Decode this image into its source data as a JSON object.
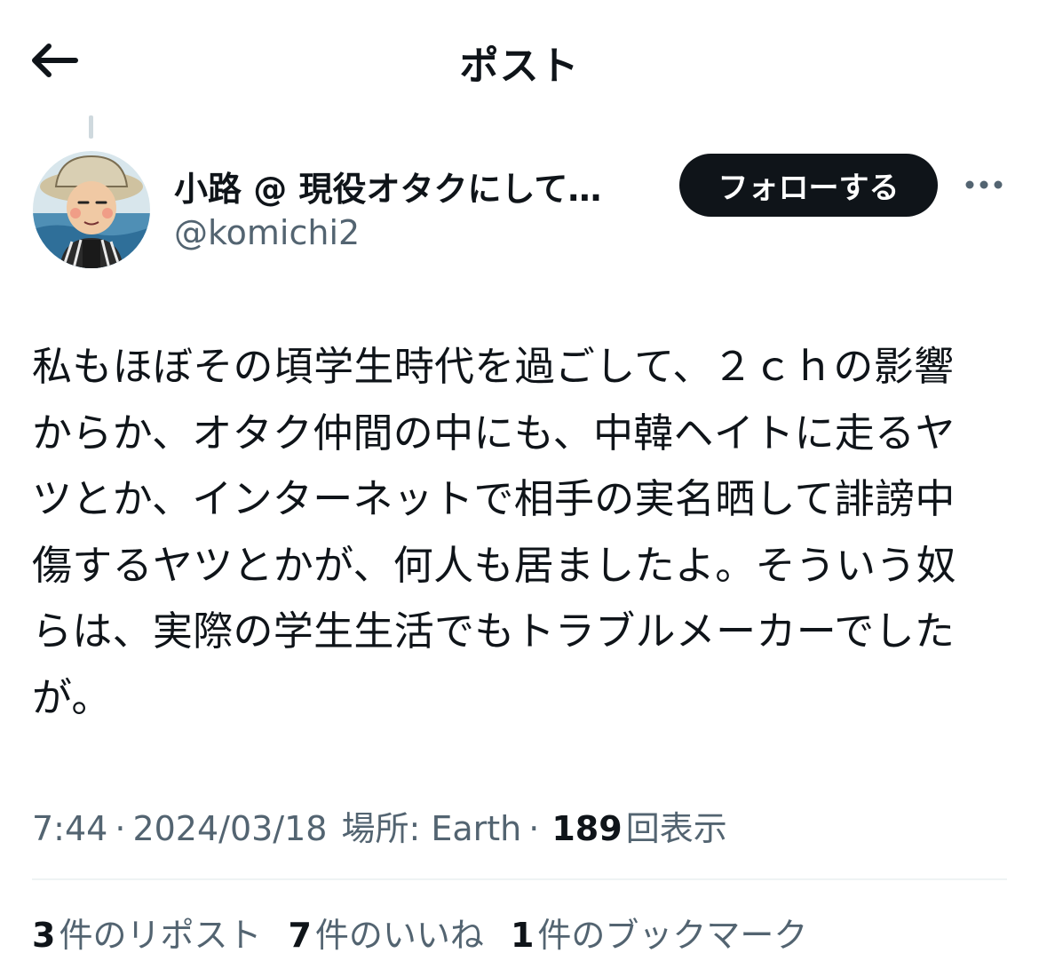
{
  "header": {
    "title": "ポスト",
    "back_icon": "arrow-left-icon"
  },
  "author": {
    "name": "小路 @ 現役オタクにして…",
    "handle": "@komichi2",
    "follow_label": "フォローする",
    "more_icon": "ellipsis-icon"
  },
  "post": {
    "text": "私もほぼその頃学生時代を過ごして、２ｃｈの影響\nからか、オタク仲間の中にも、中韓ヘイトに走るヤ\nツとか、インターネットで相手の実名晒して誹謗中\n傷するヤツとかが、何人も居ましたよ。そういう奴\nらは、実際の学生生活でもトラブルメーカーでした\nが。",
    "time": "7:44",
    "date": "2024/03/18",
    "location": "場所: Earth",
    "sep": "·",
    "views_count": "189",
    "views_label": "回表示"
  },
  "stats": [
    {
      "count": "3",
      "label": "件のリポスト"
    },
    {
      "count": "7",
      "label": "件のいいね"
    },
    {
      "count": "1",
      "label": "件のブックマーク"
    }
  ],
  "colors": {
    "text": "#0f1419",
    "secondary": "#536471",
    "button_bg": "#0f1419",
    "divider": "#eff3f4"
  }
}
